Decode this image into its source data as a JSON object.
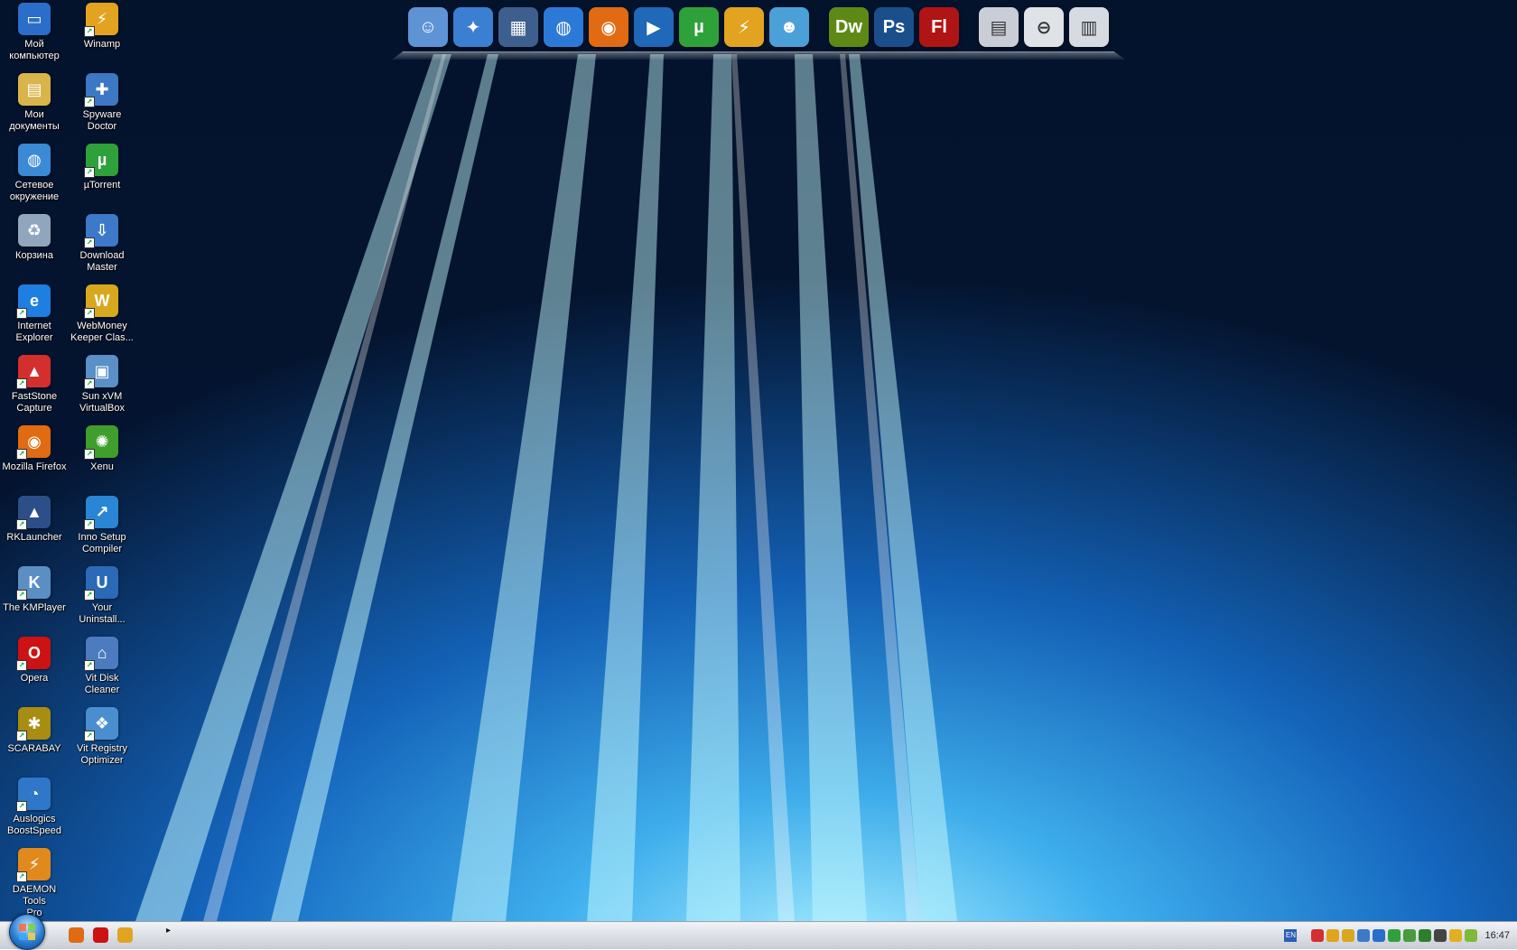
{
  "desktop_icons": [
    {
      "label": "Мой\nкомпьютер",
      "icon": "my-computer-icon",
      "color": "#2a6ec9",
      "glyph": "▭"
    },
    {
      "label": "Мои\nдокументы",
      "icon": "my-documents-icon",
      "color": "#d9b44a",
      "glyph": "▤"
    },
    {
      "label": "Сетевое\nокружение",
      "icon": "network-places-icon",
      "color": "#3a8ad6",
      "glyph": "◍"
    },
    {
      "label": "Корзина",
      "icon": "recycle-bin-icon",
      "color": "#8fa6bd",
      "glyph": "♻"
    },
    {
      "label": "Internet\nExplorer",
      "icon": "internet-explorer-icon",
      "color": "#1f7fe0",
      "glyph": "e"
    },
    {
      "label": "FastStone\nCapture",
      "icon": "faststone-capture-icon",
      "color": "#d32f2f",
      "glyph": "▲"
    },
    {
      "label": "Mozilla Firefox",
      "icon": "firefox-icon",
      "color": "#e06b12",
      "glyph": "◉"
    },
    {
      "label": "RKLauncher",
      "icon": "rklauncher-icon",
      "color": "#2c4f8a",
      "glyph": "▲"
    },
    {
      "label": "The KMPlayer",
      "icon": "kmplayer-icon",
      "color": "#5b8fc4",
      "glyph": "K"
    },
    {
      "label": "Opera",
      "icon": "opera-icon",
      "color": "#cc1212",
      "glyph": "O"
    },
    {
      "label": "SCARABAY",
      "icon": "scarabay-icon",
      "color": "#a88d13",
      "glyph": "✱"
    },
    {
      "label": "Auslogics\nBoostSpeed",
      "icon": "auslogics-boostspeed-icon",
      "color": "#2f77c9",
      "glyph": "◔"
    },
    {
      "label": "DAEMON Tools\nPro",
      "icon": "daemon-tools-icon",
      "color": "#e08a1e",
      "glyph": "⚡"
    },
    {
      "label": "Winamp",
      "icon": "winamp-icon",
      "color": "#e2a320",
      "glyph": "⚡"
    },
    {
      "label": "Spyware\nDoctor",
      "icon": "spyware-doctor-icon",
      "color": "#3c78c4",
      "glyph": "✚"
    },
    {
      "label": "µTorrent",
      "icon": "utorrent-icon",
      "color": "#2fa13b",
      "glyph": "µ"
    },
    {
      "label": "Download\nMaster",
      "icon": "download-master-icon",
      "color": "#3c79c9",
      "glyph": "⇩"
    },
    {
      "label": "WebMoney\nKeeper Clas...",
      "icon": "webmoney-keeper-icon",
      "color": "#d7a81e",
      "glyph": "W"
    },
    {
      "label": "Sun xVM\nVirtualBox",
      "icon": "virtualbox-icon",
      "color": "#5a8fc7",
      "glyph": "▣"
    },
    {
      "label": "Xenu",
      "icon": "xenu-icon",
      "color": "#3f9e2c",
      "glyph": "✺"
    },
    {
      "label": "Inno Setup\nCompiler",
      "icon": "inno-setup-icon",
      "color": "#2a86d4",
      "glyph": "↗"
    },
    {
      "label": "Your\nUninstall...",
      "icon": "your-uninstaller-icon",
      "color": "#2b6ab8",
      "glyph": "U"
    },
    {
      "label": "Vit Disk\nCleaner",
      "icon": "vit-disk-cleaner-icon",
      "color": "#4c7bbf",
      "glyph": "⌂"
    },
    {
      "label": "Vit Registry\nOptimizer",
      "icon": "vit-registry-optimizer-icon",
      "color": "#4a8ed0",
      "glyph": "❖"
    }
  ],
  "dock": {
    "items": [
      {
        "icon": "finder-icon",
        "color": "#5e93d6",
        "glyph": "☺"
      },
      {
        "icon": "safari-icon",
        "color": "#3a7fd1",
        "glyph": "✦"
      },
      {
        "icon": "dashboard-icon",
        "color": "#3d5f8e",
        "glyph": "▦"
      },
      {
        "icon": "network-globe-icon",
        "color": "#2c7ad8",
        "glyph": "◍"
      },
      {
        "icon": "firefox-dock-icon",
        "color": "#e06b12",
        "glyph": "◉"
      },
      {
        "icon": "media-player-icon",
        "color": "#2068b8",
        "glyph": "▶"
      },
      {
        "icon": "utorrent-dock-icon",
        "color": "#2fa13b",
        "glyph": "µ"
      },
      {
        "icon": "winamp-dock-icon",
        "color": "#e2a320",
        "glyph": "⚡"
      },
      {
        "icon": "messenger-icon",
        "color": "#4ba0d8",
        "glyph": "☻"
      },
      {
        "icon": "dreamweaver-icon",
        "color": "#5d8a16",
        "glyph": "Dw"
      },
      {
        "icon": "photoshop-icon",
        "color": "#1b4f8c",
        "glyph": "Ps"
      },
      {
        "icon": "flash-icon",
        "color": "#b01414",
        "glyph": "Fl"
      },
      {
        "icon": "printer-drive-icon",
        "color": "#c9ced6",
        "glyph": "▤"
      },
      {
        "icon": "removable-drive-icon",
        "color": "#dfe3e8",
        "glyph": "⊖"
      },
      {
        "icon": "external-drive-icon",
        "color": "#d6dbe2",
        "glyph": "▥"
      }
    ]
  },
  "taskbar": {
    "quick_launch": [
      {
        "icon": "firefox-quicklaunch-icon",
        "color": "#e06b12"
      },
      {
        "icon": "opera-quicklaunch-icon",
        "color": "#cc1212"
      },
      {
        "icon": "winamp-quicklaunch-icon",
        "color": "#e2a320"
      }
    ],
    "language": "EN",
    "tray_icons": [
      {
        "icon": "faststone-tray-icon",
        "color": "#d32f2f"
      },
      {
        "icon": "winamp-tray-icon",
        "color": "#e2a320"
      },
      {
        "icon": "webmoney-tray-icon",
        "color": "#d7a81e"
      },
      {
        "icon": "download-master-tray-icon",
        "color": "#3c79c9"
      },
      {
        "icon": "network-tray-icon",
        "color": "#2a6ec9"
      },
      {
        "icon": "utorrent-tray-icon",
        "color": "#2fa13b"
      },
      {
        "icon": "security-tray-icon",
        "color": "#4b9b3e"
      },
      {
        "icon": "hardware-tray-icon",
        "color": "#2d7f2d"
      },
      {
        "icon": "volume-tray-icon",
        "color": "#444444"
      },
      {
        "icon": "messenger-tray-icon",
        "color": "#e0b020"
      },
      {
        "icon": "battery-tray-icon",
        "color": "#7fb93a"
      }
    ],
    "clock": "16:47"
  }
}
